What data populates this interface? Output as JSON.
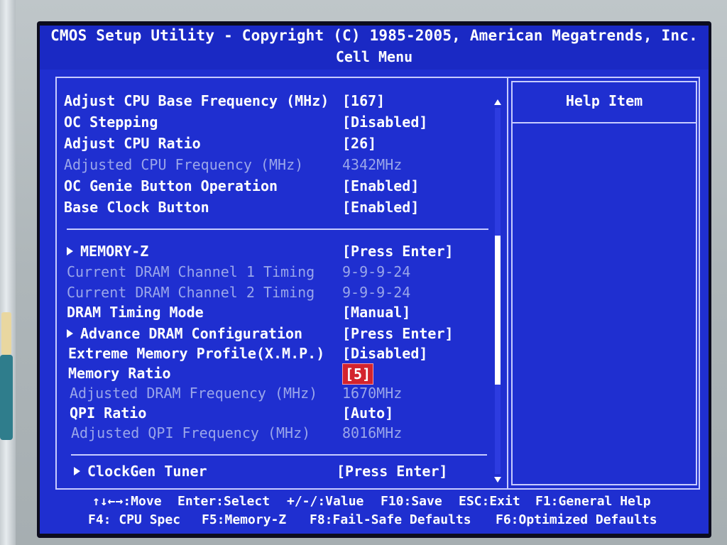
{
  "header": {
    "title": "CMOS Setup Utility - Copyright (C) 1985-2005, American Megatrends, Inc.",
    "subtitle": "Cell Menu"
  },
  "menu": {
    "group1": [
      {
        "label": "Adjust CPU Base Frequency (MHz)",
        "value": "[167]",
        "dim": false
      },
      {
        "label": "OC Stepping",
        "value": "[Disabled]",
        "dim": false
      },
      {
        "label": "Adjust CPU Ratio",
        "value": "[26]",
        "dim": false
      },
      {
        "label": "Adjusted CPU Frequency (MHz)",
        "value": "4342MHz",
        "dim": true
      },
      {
        "label": "OC Genie Button Operation",
        "value": "[Enabled]",
        "dim": false
      },
      {
        "label": "Base Clock Button",
        "value": "[Enabled]",
        "dim": false
      }
    ],
    "group2": [
      {
        "label": "MEMORY-Z",
        "value": "[Press Enter]",
        "dim": false,
        "submenu": true
      },
      {
        "label": "Current DRAM Channel 1 Timing",
        "value": "9-9-9-24",
        "dim": true
      },
      {
        "label": "Current DRAM Channel 2 Timing",
        "value": "9-9-9-24",
        "dim": true
      },
      {
        "label": "DRAM Timing Mode",
        "value": "[Manual]",
        "dim": false
      },
      {
        "label": "Advance DRAM Configuration",
        "value": "[Press Enter]",
        "dim": false,
        "submenu": true
      },
      {
        "label": "Extreme Memory Profile(X.M.P.)",
        "value": "[Disabled]",
        "dim": false
      },
      {
        "label": "Memory Ratio",
        "value": "[5]",
        "dim": false,
        "selected": true
      },
      {
        "label": "Adjusted DRAM Frequency (MHz)",
        "value": "1670MHz",
        "dim": true
      },
      {
        "label": "QPI Ratio",
        "value": "[Auto]",
        "dim": false
      },
      {
        "label": "Adjusted QPI Frequency (MHz)",
        "value": "8016MHz",
        "dim": true
      }
    ],
    "group3": [
      {
        "label": "ClockGen Tuner",
        "value": "[Press Enter]",
        "dim": false,
        "submenu": true
      }
    ]
  },
  "help": {
    "title": "Help Item"
  },
  "footer": {
    "line1": [
      "↑↓←→:Move",
      "Enter:Select",
      "+/-/:Value",
      "F10:Save",
      "ESC:Exit",
      "F1:General Help"
    ],
    "line2": [
      "F4: CPU Spec",
      "F5:Memory-Z",
      "F8:Fail-Safe Defaults",
      "F6:Optimized Defaults"
    ]
  },
  "colors": {
    "background": "#1f2fd0",
    "text": "#ffffff",
    "dim_text": "#9aa6ea",
    "selected": "#d3242e",
    "border": "#c8ccff"
  }
}
